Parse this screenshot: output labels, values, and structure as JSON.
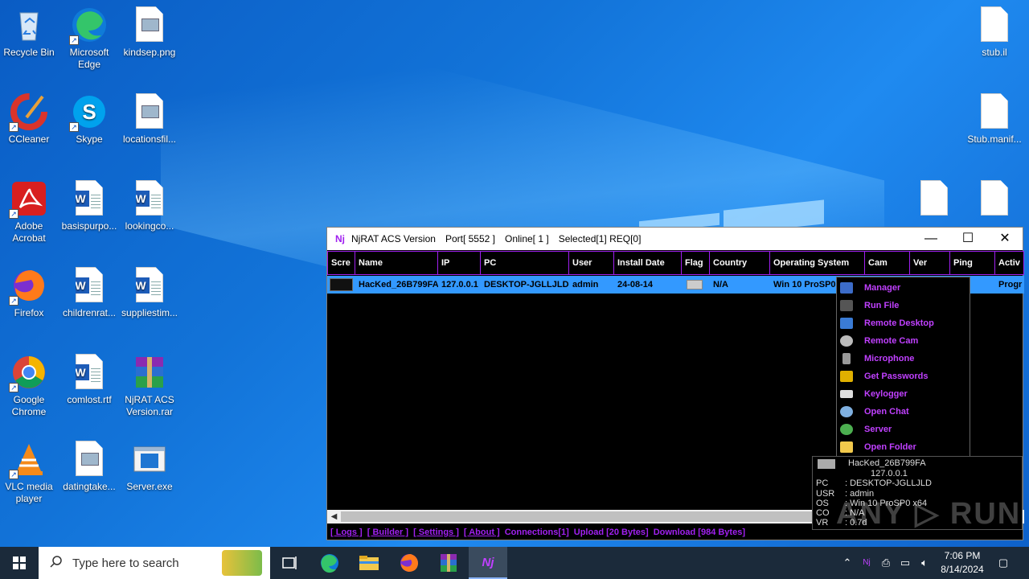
{
  "desktop": {
    "icons": [
      {
        "label": "Recycle Bin",
        "icon": "recycle-bin-icon"
      },
      {
        "label": "Microsoft Edge",
        "icon": "edge-icon"
      },
      {
        "label": "kindsep.png",
        "icon": "image-file-icon"
      },
      {
        "label": "CCleaner",
        "icon": "ccleaner-icon"
      },
      {
        "label": "Skype",
        "icon": "skype-icon"
      },
      {
        "label": "locationsfil...",
        "icon": "image-file-icon"
      },
      {
        "label": "Adobe Acrobat",
        "icon": "acrobat-icon"
      },
      {
        "label": "basispurpo...",
        "icon": "word-doc-icon"
      },
      {
        "label": "lookingco...",
        "icon": "word-doc-icon"
      },
      {
        "label": "Firefox",
        "icon": "firefox-icon"
      },
      {
        "label": "childrenrat...",
        "icon": "word-doc-icon"
      },
      {
        "label": "suppliestim...",
        "icon": "word-doc-icon"
      },
      {
        "label": "Google Chrome",
        "icon": "chrome-icon"
      },
      {
        "label": "comlost.rtf",
        "icon": "word-doc-icon"
      },
      {
        "label": "NjRAT ACS Version.rar",
        "icon": "winrar-icon"
      },
      {
        "label": "VLC media player",
        "icon": "vlc-icon"
      },
      {
        "label": "datingtake...",
        "icon": "image-file-icon"
      },
      {
        "label": "Server.exe",
        "icon": "exe-icon"
      },
      {
        "label": "stub.il",
        "icon": "blank-file-icon"
      },
      {
        "label": "Stub.manif...",
        "icon": "blank-file-icon"
      }
    ]
  },
  "window": {
    "title": "NjRAT ACS Version",
    "port": "Port[ 5552 ]",
    "online": "Online[ 1 ]",
    "selected": "Selected[1] REQ[0]",
    "minimize": "—",
    "maximize": "☐",
    "close": "✕"
  },
  "table": {
    "headers": [
      "Scre",
      "Name",
      "IP",
      "PC",
      "User",
      "Install Date",
      "Flag",
      "Country",
      "Operating System",
      "Cam",
      "Ver",
      "Ping",
      "Activ"
    ],
    "row": {
      "name": "HacKed_26B799FA",
      "ip": "127.0.0.1",
      "pc": "DESKTOP-JGLLJLD",
      "user": "admin",
      "install_date": "24-08-14",
      "country": "N/A",
      "os": "Win 10 ProSP0",
      "active": "Progr"
    }
  },
  "context_menu": {
    "items": [
      {
        "label": "Manager",
        "icon": "manager-icon",
        "color": "#3c6cc8"
      },
      {
        "label": "Run File",
        "icon": "run-file-icon",
        "color": "#555555"
      },
      {
        "label": "Remote Desktop",
        "icon": "monitor-icon",
        "color": "#3a7bd5"
      },
      {
        "label": "Remote Cam",
        "icon": "webcam-icon",
        "color": "#bbbbbb"
      },
      {
        "label": "Microphone",
        "icon": "microphone-icon",
        "color": "#999999"
      },
      {
        "label": "Get Passwords",
        "icon": "key-icon",
        "color": "#e0b000"
      },
      {
        "label": "Keylogger",
        "icon": "keyboard-icon",
        "color": "#dddddd"
      },
      {
        "label": "Open Chat",
        "icon": "chat-icon",
        "color": "#7fb0e0"
      },
      {
        "label": "Server",
        "icon": "server-gear-icon",
        "color": "#4caf50"
      },
      {
        "label": "Open Folder",
        "icon": "folder-icon",
        "color": "#f2c94c"
      }
    ]
  },
  "tooltip": {
    "name": "HacKed_26B799FA",
    "ip": "127.0.0.1",
    "rows": [
      {
        "k": "PC",
        "v": ": DESKTOP-JGLLJLD"
      },
      {
        "k": "USR",
        "v": ": admin"
      },
      {
        "k": "OS",
        "v": ": Win 10 ProSP0 x64"
      },
      {
        "k": "CO",
        "v": ": N/A"
      },
      {
        "k": "VR",
        "v": ": 0.7d"
      }
    ]
  },
  "statusbar": {
    "logs": "[ Logs ]",
    "builder": "[ Builder ]",
    "settings": "[ Settings ]",
    "about": "[ About ]",
    "connections": "Connections[1]",
    "upload": "Upload [20 Bytes]",
    "download": "Download [984 Bytes]"
  },
  "taskbar": {
    "search_placeholder": "Type here to search",
    "time": "7:06 PM",
    "date": "8/14/2024"
  }
}
